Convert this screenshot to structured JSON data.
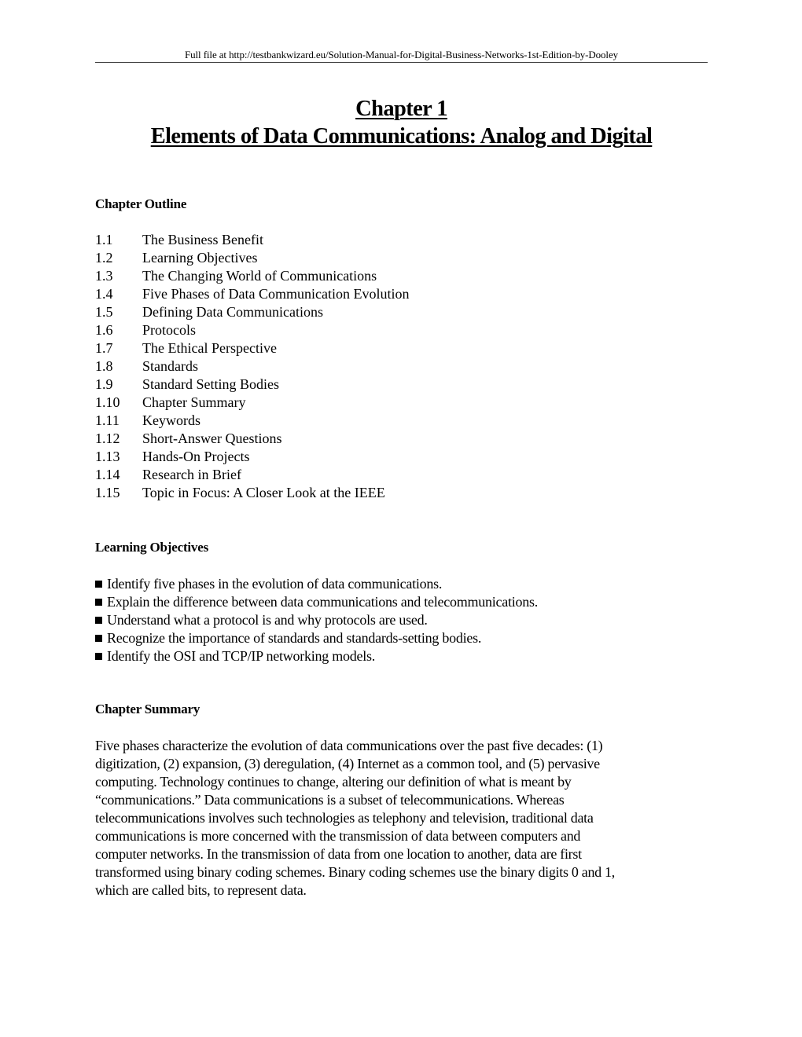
{
  "header": {
    "note": "Full file at http://testbankwizard.eu/Solution-Manual-for-Digital-Business-Networks-1st-Edition-by-Dooley"
  },
  "title": {
    "chapter": "Chapter 1",
    "subtitle": "Elements of Data Communications: Analog and Digital"
  },
  "outline": {
    "heading": "Chapter Outline",
    "items": [
      {
        "num": "1.1",
        "label": "The Business Benefit"
      },
      {
        "num": "1.2",
        "label": "Learning Objectives"
      },
      {
        "num": "1.3",
        "label": "The Changing World of Communications"
      },
      {
        "num": "1.4",
        "label": "Five Phases of Data Communication Evolution"
      },
      {
        "num": "1.5",
        "label": "Defining Data Communications"
      },
      {
        "num": "1.6",
        "label": "Protocols"
      },
      {
        "num": "1.7",
        "label": "The Ethical Perspective"
      },
      {
        "num": "1.8",
        "label": "Standards"
      },
      {
        "num": "1.9",
        "label": "Standard Setting Bodies"
      },
      {
        "num": "1.10",
        "label": "Chapter Summary"
      },
      {
        "num": "1.11",
        "label": "Keywords"
      },
      {
        "num": "1.12",
        "label": "Short-Answer Questions"
      },
      {
        "num": "1.13",
        "label": "Hands-On Projects"
      },
      {
        "num": "1.14",
        "label": "Research in Brief"
      },
      {
        "num": "1.15",
        "label": "Topic in Focus: A Closer Look at the IEEE"
      }
    ]
  },
  "objectives": {
    "heading": "Learning Objectives",
    "items": [
      "Identify five phases in the evolution of data communications.",
      "Explain the difference between data communications and telecommunications.",
      "Understand what a protocol is and why protocols are used.",
      "Recognize the importance of standards and standards-setting bodies.",
      "Identify the OSI and TCP/IP networking models."
    ]
  },
  "summary": {
    "heading": "Chapter Summary",
    "lines": [
      "Five phases characterize the evolution of data communications over the past five decades: (1)",
      "digitization, (2) expansion, (3) deregulation, (4) Internet as a common tool, and (5) pervasive",
      "computing. Technology continues to change, altering our definition of what is meant by",
      "“communications.” Data communications is a subset of telecommunications. Whereas",
      "telecommunications involves such technologies as telephony and television, traditional data",
      "communications is more concerned with the transmission of data between computers and",
      "computer networks. In the transmission of data from one location to another, data are first",
      "transformed using binary coding schemes. Binary coding schemes use the binary digits 0 and 1,",
      "which are called bits, to represent data."
    ]
  }
}
